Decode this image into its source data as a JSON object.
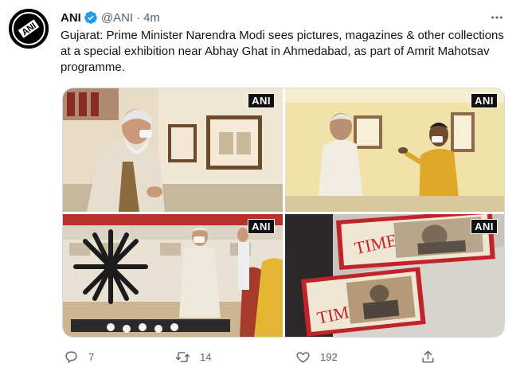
{
  "author": {
    "name": "ANI",
    "handle": "@ANI",
    "separator": "·",
    "time": "4m",
    "avatar_text": "ANI"
  },
  "tweet_text": "Gujarat: Prime Minister Narendra Modi sees pictures, magazines & other collections at a special exhibition near Abhay Ghat in Ahmedabad, as part of Amrit Mahotsav programme.",
  "media": {
    "watermark": "ANI",
    "magazine_title": "TIME"
  },
  "actions": {
    "replies": "7",
    "retweets": "14",
    "likes": "192"
  },
  "icons": {
    "verified": "verified-badge-icon",
    "more": "more-icon",
    "reply": "reply-icon",
    "retweet": "retweet-icon",
    "like": "like-icon",
    "share": "share-icon"
  },
  "colors": {
    "verified": "#1d9bf0",
    "secondary_text": "#536471",
    "border": "#cfd9de"
  }
}
